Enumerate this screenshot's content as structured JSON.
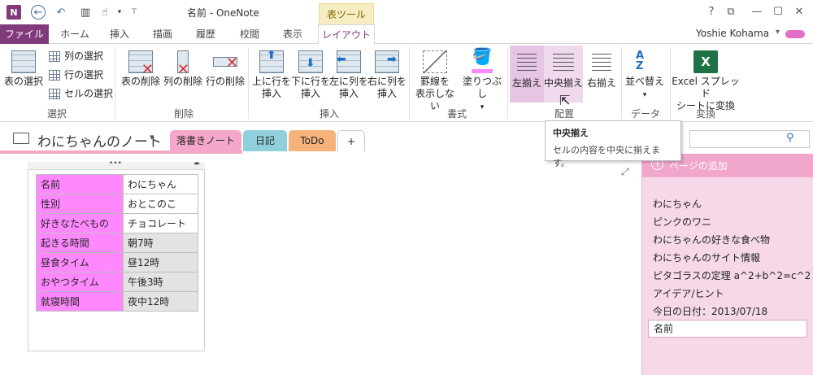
{
  "window": {
    "title": "名前 - OneNote",
    "tool_tab_header": "表ツール",
    "help": "?",
    "restore": "⧉",
    "minimize": "—",
    "maximize": "☐",
    "close": "✕"
  },
  "tabs": [
    "ファイル",
    "ホーム",
    "挿入",
    "描画",
    "履歴",
    "校閲",
    "表示",
    "レイアウト"
  ],
  "active_tab": "レイアウト",
  "user": {
    "name": "Yoshie Kohama",
    "caret": "▾"
  },
  "ribbon": {
    "select": {
      "table_select": "表の選択",
      "col_select": "列の選択",
      "row_select": "行の選択",
      "cell_select": "セルの選択",
      "label": "選択"
    },
    "delete": {
      "table_delete": "表の削除",
      "col_delete": "列の削除",
      "row_delete": "行の削除",
      "label": "削除"
    },
    "insert": {
      "above_1": "上に行を",
      "above_2": "挿入",
      "below_1": "下に行を",
      "below_2": "挿入",
      "left_1": "左に列を",
      "left_2": "挿入",
      "right_1": "右に列を",
      "right_2": "挿入",
      "label": "挿入"
    },
    "format": {
      "hide_borders_1": "罫線を",
      "hide_borders_2": "表示しない",
      "shading": "塗りつぶし",
      "shading_caret": "▾",
      "label": "書式"
    },
    "align": {
      "left": "左揃え",
      "center": "中央揃え",
      "right": "右揃え",
      "label": "配置"
    },
    "data": {
      "sort": "並べ替え",
      "sort_caret": "▾",
      "label": "データ"
    },
    "convert": {
      "excel_1": "Excel スプレッド",
      "excel_2": "シートに変換",
      "label": "変換"
    }
  },
  "notebook": {
    "name": "わにちゃんのノート",
    "caret": "▾"
  },
  "sections": [
    {
      "label": "落書きノート",
      "color": "#f4a7c9",
      "active": true
    },
    {
      "label": "日記",
      "color": "#8fd0dc",
      "active": false
    },
    {
      "label": "ToDo",
      "color": "#f5b27a",
      "active": false
    },
    {
      "label": "+",
      "color": "#ffffff",
      "active": false
    }
  ],
  "table": {
    "rows": [
      {
        "label": "名前",
        "value": "わにちゃん",
        "grey": false
      },
      {
        "label": "性別",
        "value": "おとこのこ",
        "grey": false
      },
      {
        "label": "好きなたべもの",
        "value": "チョコレート",
        "grey": false
      },
      {
        "label": "起きる時間",
        "value": "朝7時",
        "grey": true
      },
      {
        "label": "昼食タイム",
        "value": "昼12時",
        "grey": true
      },
      {
        "label": "おやつタイム",
        "value": "午後3時",
        "grey": true
      },
      {
        "label": "就寝時間",
        "value": "夜中12時",
        "grey": true
      }
    ]
  },
  "pages": {
    "add_page": "ページの追加",
    "items": [
      "わにちゃん",
      "ピンクのワニ",
      "わにちゃんの好きな食べ物",
      "わにちゃんのサイト情報",
      "ピタゴラスの定理  a^2+b^2=c^2",
      "アイデア/ヒント",
      "今日の日付：2013/07/18"
    ],
    "current": "名前"
  },
  "search": {
    "icon": "⚲"
  },
  "tooltip": {
    "title": "中央揃え",
    "body": "セルの内容を中央に揃えます。"
  },
  "colors": {
    "accent": "#80397b",
    "section_pink": "#f4a7c9",
    "label_cell": "#ff88ff",
    "panel": "#f6d8e9"
  }
}
